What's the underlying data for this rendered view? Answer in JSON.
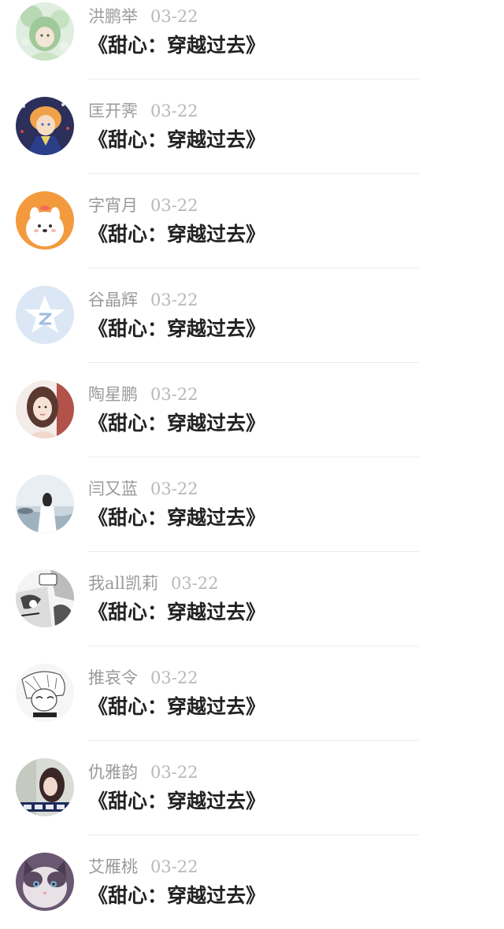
{
  "feed": {
    "items": [
      {
        "name": "洪鹏举",
        "date": "03-22",
        "title": "《甜心：穿越过去》",
        "avatar": "anime-green-hair-avatar"
      },
      {
        "name": "匡开霁",
        "date": "03-22",
        "title": "《甜心：穿越过去》",
        "avatar": "anime-orange-hair-avatar"
      },
      {
        "name": "字宵月",
        "date": "03-22",
        "title": "《甜心：穿越过去》",
        "avatar": "cartoon-bunny-avatar"
      },
      {
        "name": "谷晶辉",
        "date": "03-22",
        "title": "《甜心：穿越过去》",
        "avatar": "default-star-avatar"
      },
      {
        "name": "陶星鹏",
        "date": "03-22",
        "title": "《甜心：穿越过去》",
        "avatar": "girl-portrait-avatar"
      },
      {
        "name": "闫又蓝",
        "date": "03-22",
        "title": "《甜心：穿越过去》",
        "avatar": "girl-seaside-avatar"
      },
      {
        "name": "我all凯莉",
        "date": "03-22",
        "title": "《甜心：穿越过去》",
        "avatar": "manga-panel-avatar"
      },
      {
        "name": "推哀令",
        "date": "03-22",
        "title": "《甜心：穿越过去》",
        "avatar": "manga-sketch-avatar"
      },
      {
        "name": "仇雅韵",
        "date": "03-22",
        "title": "《甜心：穿越过去》",
        "avatar": "girl-photo-avatar"
      },
      {
        "name": "艾雁桃",
        "date": "03-22",
        "title": "《甜心：穿越过去》",
        "avatar": "cat-avatar"
      }
    ]
  },
  "colors": {
    "name": "#9a9a9a",
    "date": "#b8b8b8",
    "title": "#222222",
    "divider": "#ececec"
  }
}
